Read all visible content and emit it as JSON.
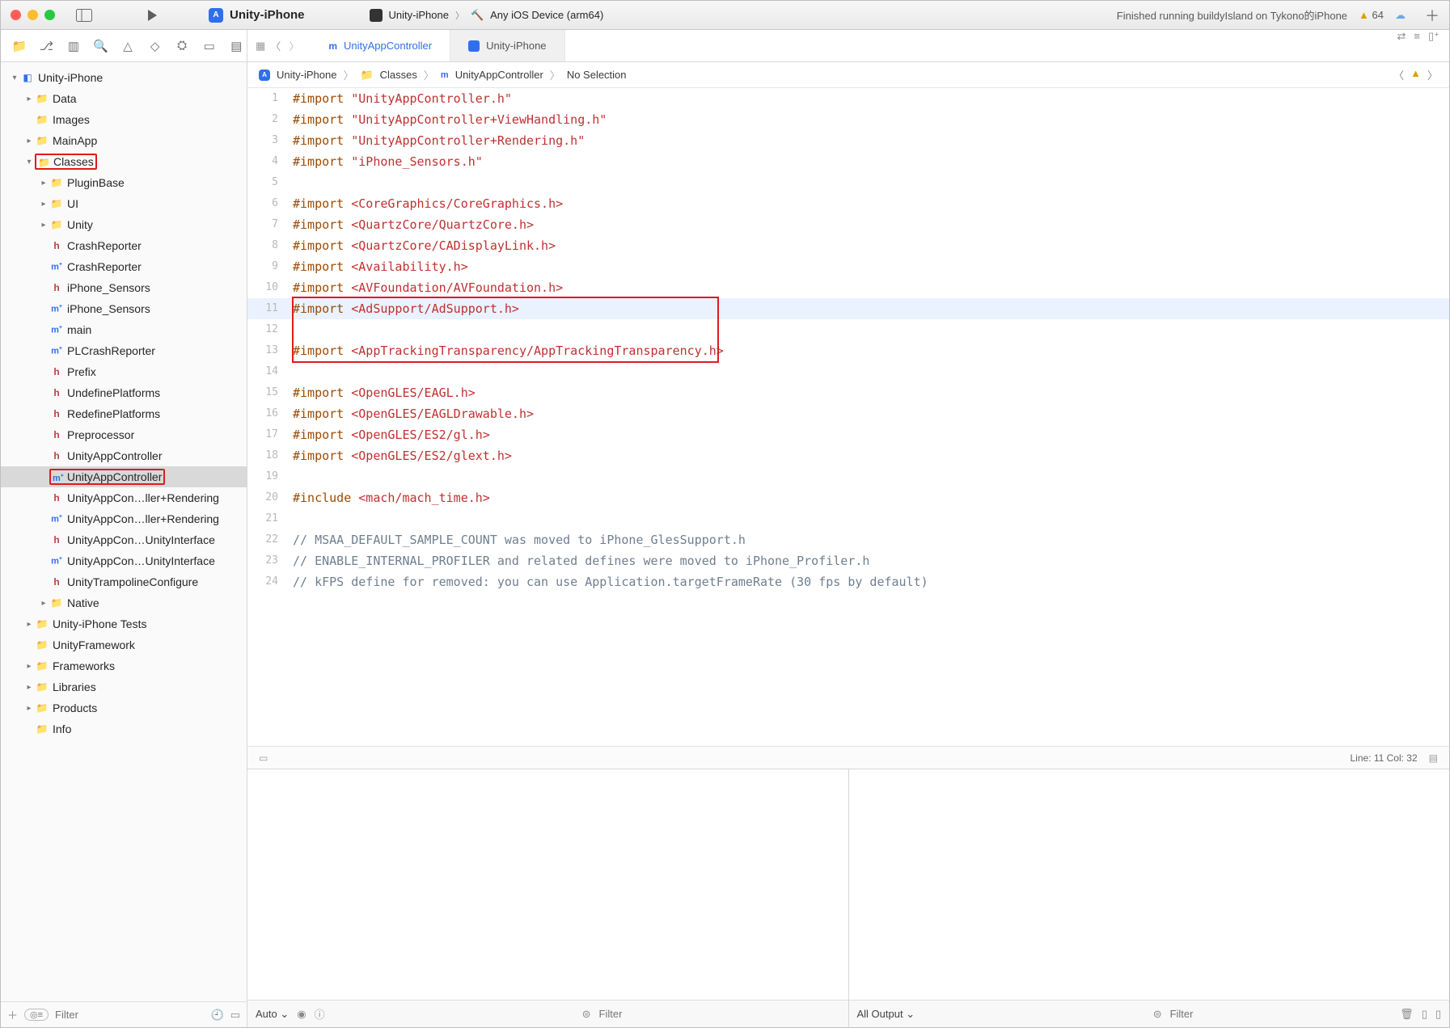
{
  "titlebar": {
    "scheme": "Unity-iPhone",
    "scheme2": "Unity-iPhone",
    "destination": "Any iOS Device (arm64)",
    "status": "Finished running buildyIsland on Tykono的iPhone",
    "warnings": "64"
  },
  "tabs": {
    "active": "UnityAppController",
    "second": "Unity-iPhone"
  },
  "breadcrumb": {
    "project": "Unity-iPhone",
    "group": "Classes",
    "file": "UnityAppController",
    "selection": "No Selection"
  },
  "tree": [
    {
      "d": 0,
      "t": "proj",
      "disc": "v",
      "label": "Unity-iPhone"
    },
    {
      "d": 1,
      "t": "folder",
      "disc": ">",
      "label": "Data"
    },
    {
      "d": 1,
      "t": "folder",
      "disc": "",
      "label": "Images"
    },
    {
      "d": 1,
      "t": "folder",
      "disc": ">",
      "label": "MainApp"
    },
    {
      "d": 1,
      "t": "folder",
      "disc": "v",
      "label": "Classes",
      "hl": true
    },
    {
      "d": 2,
      "t": "folder",
      "disc": ">",
      "label": "PluginBase"
    },
    {
      "d": 2,
      "t": "folder",
      "disc": ">",
      "label": "UI"
    },
    {
      "d": 2,
      "t": "folder",
      "disc": ">",
      "label": "Unity"
    },
    {
      "d": 2,
      "t": "h",
      "label": "CrashReporter"
    },
    {
      "d": 2,
      "t": "m",
      "label": "CrashReporter"
    },
    {
      "d": 2,
      "t": "h",
      "label": "iPhone_Sensors"
    },
    {
      "d": 2,
      "t": "m",
      "label": "iPhone_Sensors"
    },
    {
      "d": 2,
      "t": "m",
      "label": "main"
    },
    {
      "d": 2,
      "t": "m",
      "label": "PLCrashReporter"
    },
    {
      "d": 2,
      "t": "h",
      "label": "Prefix"
    },
    {
      "d": 2,
      "t": "h",
      "label": "UndefinePlatforms"
    },
    {
      "d": 2,
      "t": "h",
      "label": "RedefinePlatforms"
    },
    {
      "d": 2,
      "t": "h",
      "label": "Preprocessor"
    },
    {
      "d": 2,
      "t": "h",
      "label": "UnityAppController"
    },
    {
      "d": 2,
      "t": "m",
      "label": "UnityAppController",
      "sel": true,
      "hl": true
    },
    {
      "d": 2,
      "t": "h",
      "label": "UnityAppCon…ller+Rendering"
    },
    {
      "d": 2,
      "t": "m",
      "label": "UnityAppCon…ller+Rendering"
    },
    {
      "d": 2,
      "t": "h",
      "label": "UnityAppCon…UnityInterface"
    },
    {
      "d": 2,
      "t": "m",
      "label": "UnityAppCon…UnityInterface"
    },
    {
      "d": 2,
      "t": "h",
      "label": "UnityTrampolineConfigure"
    },
    {
      "d": 2,
      "t": "folder",
      "disc": ">",
      "label": "Native"
    },
    {
      "d": 1,
      "t": "folder",
      "disc": ">",
      "label": "Unity-iPhone Tests"
    },
    {
      "d": 1,
      "t": "folder",
      "disc": "",
      "label": "UnityFramework"
    },
    {
      "d": 1,
      "t": "folder",
      "disc": ">",
      "label": "Frameworks"
    },
    {
      "d": 1,
      "t": "folder",
      "disc": ">",
      "label": "Libraries"
    },
    {
      "d": 1,
      "t": "folder",
      "disc": ">",
      "label": "Products"
    },
    {
      "d": 1,
      "t": "folder",
      "disc": "",
      "label": "Info"
    }
  ],
  "code": [
    {
      "n": 1,
      "k": "#import",
      "s": "\"UnityAppController.h\""
    },
    {
      "n": 2,
      "k": "#import",
      "s": "\"UnityAppController+ViewHandling.h\""
    },
    {
      "n": 3,
      "k": "#import",
      "s": "\"UnityAppController+Rendering.h\""
    },
    {
      "n": 4,
      "k": "#import",
      "s": "\"iPhone_Sensors.h\""
    },
    {
      "n": 5
    },
    {
      "n": 6,
      "k": "#import",
      "s": "<CoreGraphics/CoreGraphics.h>"
    },
    {
      "n": 7,
      "k": "#import",
      "s": "<QuartzCore/QuartzCore.h>"
    },
    {
      "n": 8,
      "k": "#import",
      "s": "<QuartzCore/CADisplayLink.h>"
    },
    {
      "n": 9,
      "k": "#import",
      "s": "<Availability.h>"
    },
    {
      "n": 10,
      "k": "#import",
      "s": "<AVFoundation/AVFoundation.h>"
    },
    {
      "n": 11,
      "k": "#import",
      "s": "<AdSupport/AdSupport.h>",
      "cur": true
    },
    {
      "n": 12
    },
    {
      "n": 13,
      "k": "#import",
      "s": "<AppTrackingTransparency/AppTrackingTransparency.h>"
    },
    {
      "n": 14
    },
    {
      "n": 15,
      "k": "#import",
      "s": "<OpenGLES/EAGL.h>"
    },
    {
      "n": 16,
      "k": "#import",
      "s": "<OpenGLES/EAGLDrawable.h>"
    },
    {
      "n": 17,
      "k": "#import",
      "s": "<OpenGLES/ES2/gl.h>"
    },
    {
      "n": 18,
      "k": "#import",
      "s": "<OpenGLES/ES2/glext.h>"
    },
    {
      "n": 19
    },
    {
      "n": 20,
      "k": "#include",
      "s": "<mach/mach_time.h>"
    },
    {
      "n": 21
    },
    {
      "n": 22,
      "c": "// MSAA_DEFAULT_SAMPLE_COUNT was moved to iPhone_GlesSupport.h"
    },
    {
      "n": 23,
      "c": "// ENABLE_INTERNAL_PROFILER and related defines were moved to iPhone_Profiler.h"
    },
    {
      "n": 24,
      "c": "// kFPS define for removed: you can use Application.targetFrameRate (30 fps by default)"
    }
  ],
  "status": {
    "line_col": "Line: 11  Col: 32"
  },
  "debug": {
    "auto": "Auto",
    "filter": "Filter",
    "all_output": "All Output"
  },
  "sidebar_filter": "Filter"
}
